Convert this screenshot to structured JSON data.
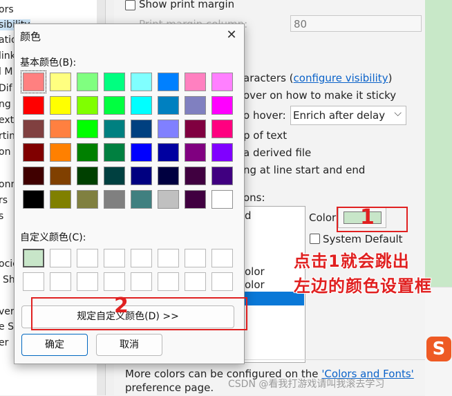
{
  "sidebar": {
    "items": [
      "ors",
      "sibility",
      "ation",
      "link",
      "l M",
      "Dif",
      "ng",
      "ext",
      "rtin",
      "on",
      "onn",
      "rs",
      "s",
      "ocie",
      "Sh",
      "ver",
      "e S",
      "er"
    ]
  },
  "pref": {
    "show_print_margin": "Show print margin",
    "print_margin_column_label": "Print margin column:",
    "print_margin_value": "80",
    "hidden_chars_prefix": "aracters (",
    "configure_visibility_link": "configure visibility",
    "hidden_chars_suffix": ")",
    "hover_sticky": "over on how to make it sticky",
    "when_hover_label": "o hover:",
    "enrich_select_value": "Enrich after delay",
    "chevron": "⌵",
    "top_of_text": "p of text",
    "derived_file": "a derived file",
    "line_start_end": "ng at line start and end",
    "options_label": "ons:",
    "list_item_d": "d",
    "list_item_color1": "olor",
    "list_item_color2": "olor",
    "color_label": "Color",
    "system_default": "System Default",
    "more_colors_text": "More colors can be configured on the ",
    "colors_fonts_link": "'Colors and Fonts'",
    "preference_page": "preference page."
  },
  "dialog": {
    "title": "颜色",
    "close": "✕",
    "basic_colors_label": "基本颜色(B):",
    "custom_colors_label": "自定义颜色(C):",
    "define_custom_button": "规定自定义颜色(D) >>",
    "ok_button": "确定",
    "cancel_button": "取消",
    "basic_colors": [
      [
        "#ff8080",
        "#ffff80",
        "#80ff80",
        "#00ff80",
        "#80ffff",
        "#0080ff",
        "#ff80c0",
        "#ff80ff"
      ],
      [
        "#ff0000",
        "#ffff00",
        "#80ff00",
        "#00ff40",
        "#00ffff",
        "#0080c0",
        "#8080c0",
        "#ff00ff"
      ],
      [
        "#804040",
        "#ff8040",
        "#00ff00",
        "#008080",
        "#004080",
        "#8080ff",
        "#800040",
        "#ff0080"
      ],
      [
        "#800000",
        "#ff8000",
        "#008000",
        "#008040",
        "#0000ff",
        "#0000a0",
        "#800080",
        "#8000ff"
      ],
      [
        "#400000",
        "#804000",
        "#004000",
        "#004040",
        "#000080",
        "#000040",
        "#400040",
        "#400080"
      ],
      [
        "#000000",
        "#808000",
        "#808040",
        "#808080",
        "#408080",
        "#c0c0c0",
        "#400040",
        "#ffffff"
      ]
    ],
    "custom_colors": [
      [
        "#c8e6c9",
        "#ffffff",
        "#ffffff",
        "#ffffff",
        "#ffffff",
        "#ffffff",
        "#ffffff",
        "#ffffff"
      ],
      [
        "#ffffff",
        "#ffffff",
        "#ffffff",
        "#ffffff",
        "#ffffff",
        "#ffffff",
        "#ffffff",
        "#ffffff"
      ]
    ]
  },
  "annotations": {
    "marker_1": "1",
    "marker_2": "2",
    "note_line1": "点击1就会跳出",
    "note_line2": "左边的颜色设置框"
  },
  "watermark": "CSDN @看我打游戏请叫我滚去学习",
  "sogou_logo_letter": "S",
  "colors": {
    "current_color": "#c8e6c9",
    "annotation_red": "#e02020",
    "link_blue": "#0a62c9",
    "selection_blue": "#0a78d7"
  }
}
